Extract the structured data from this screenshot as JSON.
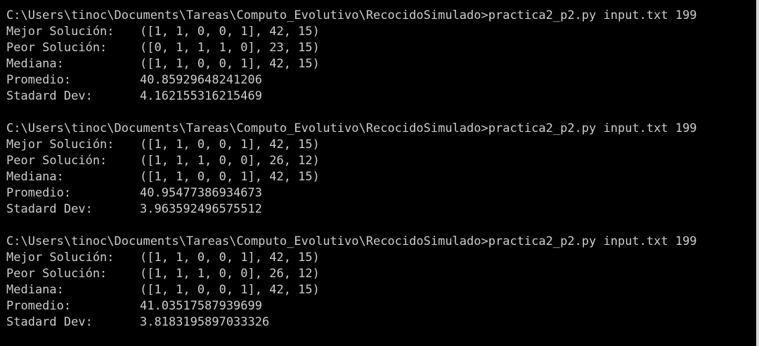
{
  "runs": [
    {
      "prompt": "C:\\Users\\tinoc\\Documents\\Tareas\\Computo_Evolutivo\\RecocidoSimulado>practica2_p2.py input.txt 199",
      "rows": [
        {
          "label": "Mejor Solución:",
          "value": "([1, 1, 0, 0, 1], 42, 15)"
        },
        {
          "label": "Peor Solución:",
          "value": "([0, 1, 1, 1, 0], 23, 15)"
        },
        {
          "label": "Mediana:",
          "value": "([1, 1, 0, 0, 1], 42, 15)"
        },
        {
          "label": "Promedio:",
          "value": "40.85929648241206"
        },
        {
          "label": "Stadard Dev:",
          "value": "4.162155316215469"
        }
      ]
    },
    {
      "prompt": "C:\\Users\\tinoc\\Documents\\Tareas\\Computo_Evolutivo\\RecocidoSimulado>practica2_p2.py input.txt 199",
      "rows": [
        {
          "label": "Mejor Solución:",
          "value": "([1, 1, 0, 0, 1], 42, 15)"
        },
        {
          "label": "Peor Solución:",
          "value": "([1, 1, 1, 0, 0], 26, 12)"
        },
        {
          "label": "Mediana:",
          "value": "([1, 1, 0, 0, 1], 42, 15)"
        },
        {
          "label": "Promedio:",
          "value": "40.95477386934673"
        },
        {
          "label": "Stadard Dev:",
          "value": "3.963592496575512"
        }
      ]
    },
    {
      "prompt": "C:\\Users\\tinoc\\Documents\\Tareas\\Computo_Evolutivo\\RecocidoSimulado>practica2_p2.py input.txt 199",
      "rows": [
        {
          "label": "Mejor Solución:",
          "value": "([1, 1, 0, 0, 1], 42, 15)"
        },
        {
          "label": "Peor Solución:",
          "value": "([1, 1, 1, 0, 0], 26, 12)"
        },
        {
          "label": "Mediana:",
          "value": "([1, 1, 0, 0, 1], 42, 15)"
        },
        {
          "label": "Promedio:",
          "value": "41.03517587939699"
        },
        {
          "label": "Stadard Dev:",
          "value": "3.8183195897033326"
        }
      ]
    }
  ],
  "colors": {
    "background": "#000000",
    "text": "#cccccc"
  }
}
